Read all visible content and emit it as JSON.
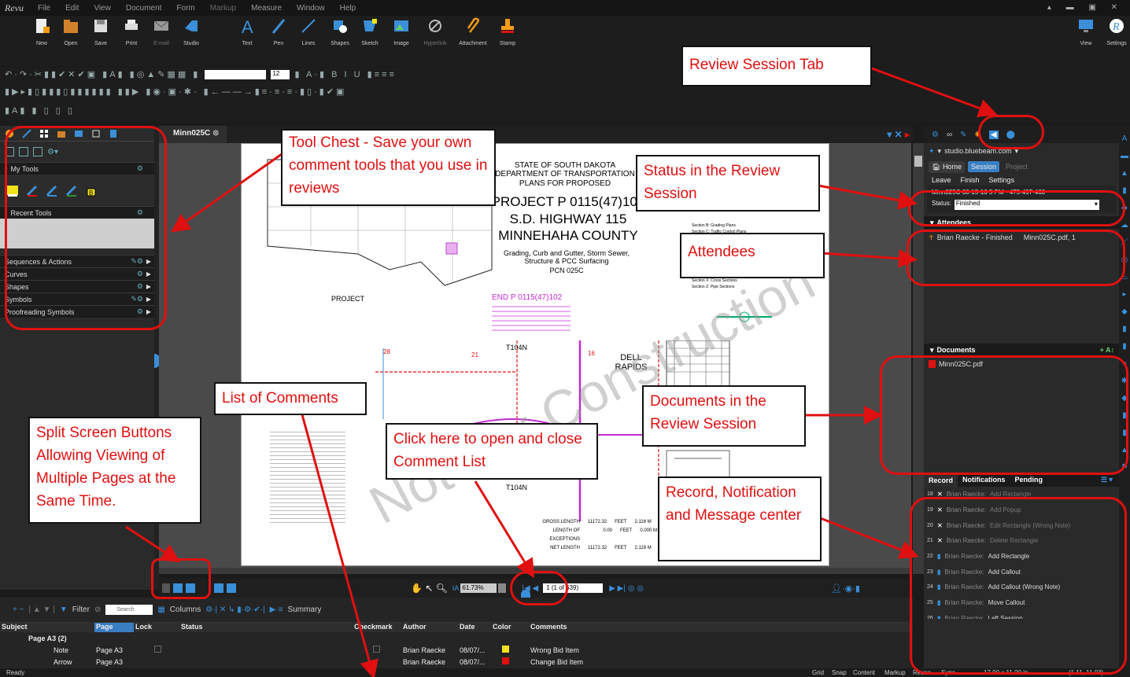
{
  "app": {
    "logo": "Revu"
  },
  "menu": [
    "File",
    "Edit",
    "View",
    "Document",
    "Form",
    "Markup",
    "Measure",
    "Window",
    "Help"
  ],
  "ribbon_left": [
    "New",
    "Open",
    "Save",
    "Print",
    "E-mail",
    "Studio"
  ],
  "ribbon_mid": [
    "Text",
    "Pen",
    "Lines",
    "Shapes",
    "Sketch",
    "Image",
    "Hyperlink",
    "Attachment",
    "Stamp"
  ],
  "ribbon_right": [
    "View",
    "Settings"
  ],
  "format": {
    "font_size": "12"
  },
  "tool_chest": {
    "my_tools": "My Tools",
    "recent_tools": "Recent Tools",
    "sections": [
      "Sequences & Actions",
      "Curves",
      "Shapes",
      "Symbols",
      "Proofreading Symbols"
    ]
  },
  "doc_tab": "Minn025C",
  "drawing": {
    "state": "STATE OF SOUTH DAKOTA",
    "dept": "DEPARTMENT OF TRANSPORTATION",
    "plans": "PLANS FOR PROPOSED",
    "project": "PROJECT P 0115(47)102",
    "highway": "S.D. HIGHWAY 115",
    "county": "MINNEHAHA COUNTY",
    "desc": "Grading, Curb and Gutter, Storm Sewer, Structure & PCC Surfacing",
    "pcn": "PCN 025C",
    "end": "END P 0115(47)102",
    "watermark": "Not For Construction",
    "project_label": "PROJECT",
    "town": "DELL RAPIDS",
    "t104n": "T104N",
    "idx1": "Section B: Grading Plans",
    "idx2": "Section C: Traffic Control Plans",
    "idx3": "Section X: Cross Sections",
    "idx4": "Section Z: Pipe Sections",
    "lengths": [
      {
        "label": "GROSS LENGTH",
        "val": "11172.32",
        "unit": "FEET",
        "mi": "2.116 M"
      },
      {
        "label": "LENGTH OF EXCEPTIONS",
        "val": "0.00",
        "unit": "FEET",
        "mi": "0.000 M"
      },
      {
        "label": "NET LENGTH",
        "val": "11172.32",
        "unit": "FEET",
        "mi": "2.116 M"
      }
    ],
    "num28": "28",
    "num21": "21",
    "num16": "16"
  },
  "nav": {
    "zoom": "61.73%",
    "page": "1 (1 of 639)"
  },
  "comments": {
    "filter": "Filter",
    "search": "Search",
    "columns": "Columns",
    "summary": "Summary",
    "headers": [
      "Subject",
      "Page",
      "Lock",
      "Status",
      "Checkmark",
      "Author",
      "Date",
      "Color",
      "Comments"
    ],
    "group": "Page A3 (2)",
    "rows": [
      {
        "subject": "Note",
        "page": "Page A3",
        "author": "Brian Raecke",
        "date": "08/07/...",
        "color": "#f2e21b",
        "comment": "Wrong Bid Item"
      },
      {
        "subject": "Arrow",
        "page": "Page A3",
        "author": "Brian Raecke",
        "date": "08/07/...",
        "color": "#e01010",
        "comment": "Change Bid Item"
      }
    ]
  },
  "studio": {
    "server": "studio.bluebeam.com",
    "buttons": [
      "Home",
      "Session",
      "Project",
      "Leave",
      "Finish",
      "Settings"
    ],
    "session_name": "Minn025C 08-15-16 5 PM - 475-497-460",
    "status_label": "Status:",
    "status_value": "Finished",
    "attendees_label": "Attendees",
    "attendee": "Brian Raecke - Finished",
    "attendee_doc": "Minn025C.pdf, 1",
    "documents_label": "Documents",
    "document": "Minn025C.pdf",
    "record_tabs": [
      "Record",
      "Notifications",
      "Pending"
    ],
    "records": [
      {
        "n": "18",
        "name": "Brian Raecke:",
        "act": "Add Rectangle"
      },
      {
        "n": "19",
        "name": "Brian Raecke:",
        "act": "Add Popup"
      },
      {
        "n": "20",
        "name": "Brian Raecke:",
        "act": "Edit Rectangle (Wrong Note)"
      },
      {
        "n": "21",
        "name": "Brian Raecke:",
        "act": "Delete Rectangle"
      },
      {
        "n": "22",
        "name": "Brian Raecke:",
        "act": "Add Rectangle"
      },
      {
        "n": "23",
        "name": "Brian Raecke:",
        "act": "Add Callout"
      },
      {
        "n": "24",
        "name": "Brian Raecke:",
        "act": "Add Callout (Wrong Note)"
      },
      {
        "n": "25",
        "name": "Brian Raecke:",
        "act": "Move Callout"
      },
      {
        "n": "26",
        "name": "Brian Raecke:",
        "act": "Left Session"
      }
    ]
  },
  "statusbar": {
    "left": "Ready",
    "items": [
      "Grid",
      "Snap",
      "Content",
      "Markup",
      "Reuse",
      "Sync"
    ],
    "size": "17.00 x 11.00 in",
    "coords": "(1.11, 11.03)"
  },
  "callouts": {
    "review_tab": "Review Session Tab",
    "tool_chest": "Tool Chest  -  Save your own comment tools that you use in reviews",
    "status": "Status in the Review Session",
    "attendees": "Attendees",
    "list_comments": "List of Comments",
    "split": "Split Screen Buttons Allowing Viewing of Multiple Pages at the Same Time.",
    "click_here": "Click here to open and close Comment List",
    "documents": "Documents in the Review Session",
    "record": "Record, Notification and Message center"
  }
}
